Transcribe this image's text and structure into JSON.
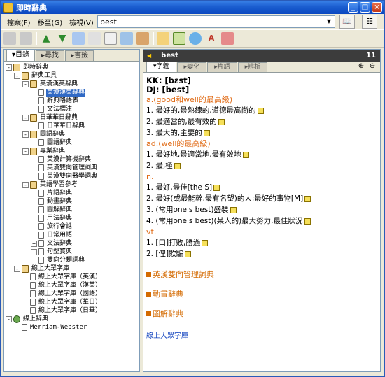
{
  "window": {
    "title": "即時辭典"
  },
  "menus": [
    "檔案(F)",
    "移至(G)",
    "檢視(V)"
  ],
  "search": {
    "value": "best"
  },
  "left_tabs": [
    "目錄",
    "尋找",
    "書籤"
  ],
  "tree": [
    {
      "label": "即時辭典",
      "level": 0,
      "toggle": "-",
      "icon": "book"
    },
    {
      "label": "辭典工具",
      "level": 1,
      "toggle": "-",
      "icon": "book"
    },
    {
      "label": "英漢漢英辭典",
      "level": 2,
      "toggle": "-",
      "icon": "book"
    },
    {
      "label": "英漢漢英辭典",
      "level": 3,
      "icon": "doc",
      "selected": true
    },
    {
      "label": "辭典略語表",
      "level": 3,
      "icon": "doc"
    },
    {
      "label": "文法標注",
      "level": 3,
      "icon": "doc"
    },
    {
      "label": "日華華日辭典",
      "level": 2,
      "toggle": "-",
      "icon": "book"
    },
    {
      "label": "日華華日辭典",
      "level": 3,
      "icon": "doc"
    },
    {
      "label": "圖語辭典",
      "level": 2,
      "toggle": "-",
      "icon": "book"
    },
    {
      "label": "圖語辭典",
      "level": 3,
      "icon": "doc"
    },
    {
      "label": "專業辭典",
      "level": 2,
      "toggle": "-",
      "icon": "book"
    },
    {
      "label": "英漢計算機辭典",
      "level": 3,
      "icon": "doc"
    },
    {
      "label": "英漢雙向管理詞典",
      "level": 3,
      "icon": "doc"
    },
    {
      "label": "英漢雙向醫學詞典",
      "level": 3,
      "icon": "doc"
    },
    {
      "label": "英語學習參考",
      "level": 2,
      "toggle": "-",
      "icon": "book"
    },
    {
      "label": "片語辭典",
      "level": 3,
      "icon": "doc"
    },
    {
      "label": "動畫辭典",
      "level": 3,
      "icon": "doc"
    },
    {
      "label": "圖解辭典",
      "level": 3,
      "icon": "doc"
    },
    {
      "label": "用法辭典",
      "level": 3,
      "icon": "doc"
    },
    {
      "label": "旅行會話",
      "level": 3,
      "icon": "doc"
    },
    {
      "label": "日常用語",
      "level": 3,
      "icon": "doc"
    },
    {
      "label": "文法辭典",
      "level": 3,
      "toggle": "+",
      "icon": "doc"
    },
    {
      "label": "句型寶典",
      "level": 3,
      "toggle": "+",
      "icon": "doc"
    },
    {
      "label": "雙向分類詞典",
      "level": 3,
      "icon": "doc"
    },
    {
      "label": "線上大眾字庫",
      "level": 1,
      "toggle": "-",
      "icon": "book"
    },
    {
      "label": "線上大眾字庫（英漢）",
      "level": 2,
      "icon": "doc"
    },
    {
      "label": "線上大眾字庫（漢英）",
      "level": 2,
      "icon": "doc"
    },
    {
      "label": "線上大眾字庫（國語）",
      "level": 2,
      "icon": "doc"
    },
    {
      "label": "線上大眾字庫（華日）",
      "level": 2,
      "icon": "doc"
    },
    {
      "label": "線上大眾字庫（日華）",
      "level": 2,
      "icon": "doc"
    },
    {
      "label": "線上辭典",
      "level": 0,
      "toggle": "-",
      "icon": "web"
    },
    {
      "label": "Merriam-Webster",
      "level": 1,
      "icon": "doc",
      "mono": true
    }
  ],
  "entry": {
    "word": "best",
    "count": "11",
    "tabs": [
      "字義",
      "變化",
      "片語",
      "辨析"
    ],
    "kk": "KK: [bɛst]",
    "dj": "DJ: [best]",
    "sections": [
      {
        "pos": "a.(good和well的最高級)",
        "defs": [
          "1. 最好的,最熟練的,道德最高尚的",
          "2. 最適當的,最有效的",
          "3. 最大的,主要的"
        ]
      },
      {
        "pos": "ad.(well的最高級)",
        "defs": [
          "1. 最好地,最適當地,最有效地",
          "2. 最,極"
        ]
      },
      {
        "pos": "n.",
        "defs": [
          "1. 最好,最佳[the S]",
          "2. 最好(或最能幹,最有名望)的人;最好的事物[M]",
          "3. (常用one's best)盛裝",
          "4. (常用one's best)(某人的)最大努力,最佳狀況"
        ]
      },
      {
        "pos": "vt.",
        "defs": [
          "1. [口]打敗,勝過",
          "2. [俚]欺騙"
        ]
      }
    ],
    "refs": [
      "英漢雙向管理詞典",
      "動畫辭典",
      "圖解辭典"
    ],
    "link": "線上大眾字庫"
  },
  "colors": {
    "pos": "#e06a14",
    "selection": "#316ac5",
    "link": "#0a3dbd"
  }
}
